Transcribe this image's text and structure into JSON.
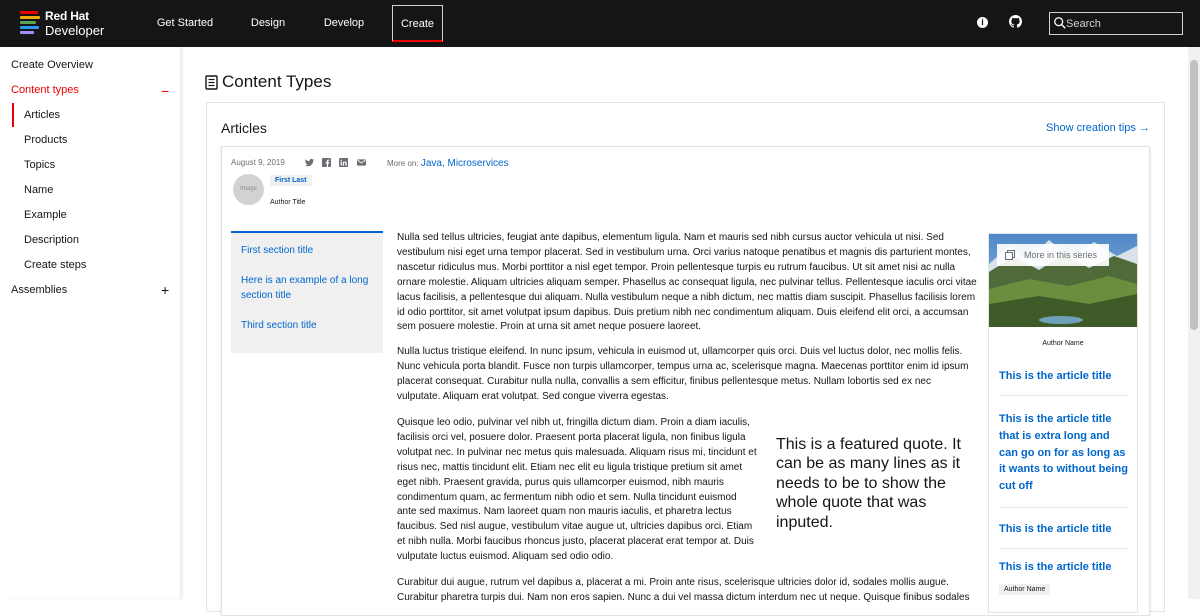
{
  "brand": {
    "line1": "Red Hat",
    "line2": "Developer",
    "bar_colors": [
      "#ee0000",
      "#f0ab00",
      "#5ba352",
      "#2b9af3",
      "#a18fff"
    ]
  },
  "nav": {
    "items": [
      {
        "label": "Get Started"
      },
      {
        "label": "Design"
      },
      {
        "label": "Develop"
      },
      {
        "label": "Create"
      }
    ],
    "active": "Create",
    "info_icon": "info-icon",
    "github_icon": "github-icon",
    "search": {
      "placeholder": "Search",
      "value": ""
    }
  },
  "sidebar": {
    "overview": "Create Overview",
    "content_types": {
      "label": "Content types",
      "toggle": "−"
    },
    "children": [
      "Articles",
      "Products",
      "Topics",
      "Name",
      "Example",
      "Description",
      "Create steps"
    ],
    "active_child": "Articles",
    "assemblies": {
      "label": "Assemblies",
      "toggle": "+"
    }
  },
  "main": {
    "title": "Content Types",
    "section_title": "Articles",
    "tips_link": "Show creation tips",
    "article": {
      "date": "August 9, 2019",
      "social_icons": [
        "twitter-icon",
        "facebook-icon",
        "linkedin-icon",
        "email-icon"
      ],
      "more_on_label": "More on:",
      "topics": "Java, Microservices",
      "avatar_placeholder": "Image",
      "author_name": "First Last",
      "author_title": "Author Title",
      "toc": [
        "First section title",
        "Here is an example of a long section title",
        "Third section title"
      ],
      "paragraphs": [
        "Nulla sed tellus ultricies, feugiat ante dapibus, elementum ligula. Nam et mauris sed nibh cursus auctor vehicula ut nisi. Sed vestibulum nisi eget urna tempor placerat. Sed in vestibulum urna. Orci varius natoque penatibus et magnis dis parturient montes, nascetur ridiculus mus. Morbi porttitor a nisl eget tempor. Proin pellentesque turpis eu rutrum faucibus. Ut sit amet nisi ac nulla ornare molestie. Aliquam ultricies aliquam semper. Phasellus ac consequat ligula, nec pulvinar tellus. Pellentesque iaculis orci vitae lacus facilisis, a pellentesque dui aliquam. Nulla vestibulum neque a nibh dictum, nec mattis diam suscipit. Phasellus facilisis lorem id odio porttitor, sit amet volutpat ipsum dapibus. Duis pretium nibh nec condimentum aliquam. Duis eleifend elit orci, a accumsan sem posuere molestie. Proin at urna sit amet neque posuere laoreet.",
        "Nulla luctus tristique eleifend. In nunc ipsum, vehicula in euismod ut, ullamcorper quis orci. Duis vel luctus dolor, nec mollis felis. Nunc vehicula porta blandit. Fusce non turpis ullamcorper, tempus urna ac, scelerisque magna. Maecenas porttitor enim id ipsum placerat consequat. Curabitur nulla nulla, convallis a sem efficitur, finibus pellentesque metus. Nullam lobortis sed ex nec vulputate. Aliquam erat volutpat. Sed congue viverra egestas.",
        "Quisque leo odio, pulvinar vel nibh ut, fringilla dictum diam. Proin a diam iaculis, facilisis orci vel, posuere dolor. Praesent porta placerat ligula, non finibus ligula volutpat nec. In pulvinar nec metus quis malesuada. Aliquam risus mi, tincidunt et risus nec, mattis tincidunt elit. Etiam nec elit eu ligula tristique pretium sit amet eget nibh. Praesent gravida, purus quis ullamcorper euismod, nibh mauris condimentum quam, ac fermentum nibh odio et sem. Nulla tincidunt euismod ante sed maximus. Nam laoreet quam non mauris iaculis, et pharetra lectus faucibus. Sed nisl augue, vestibulum vitae augue ut, ultricies dapibus orci. Etiam et nibh nulla. Morbi faucibus rhoncus justo, placerat placerat erat tempor at. Duis vulputate luctus euismod. Aliquam sed odio odio.",
        "Curabitur dui augue, rutrum vel dapibus a, placerat a mi. Proin ante risus, scelerisque ultricies dolor id, sodales mollis augue. Curabitur pharetra turpis dui. Nam non eros sapien. Nunc a dui vel massa dictum interdum nec ut neque. Quisque finibus sodales"
      ],
      "quote": "This is a featured quote. It can be as many lines as it needs to be to show the whole quote that was inputed."
    },
    "series": {
      "tag": "More in this series",
      "author": "Author Name",
      "titles": [
        "This is the article title",
        "This is the article title that is extra long and can go on for as long as it wants to without being cut off",
        "This is the article title",
        "This is the article title"
      ],
      "bottom_author": "Author Name"
    }
  },
  "colors": {
    "accent_red": "#ee0000",
    "link_blue": "#0066cc",
    "nav_bg": "#151515"
  }
}
